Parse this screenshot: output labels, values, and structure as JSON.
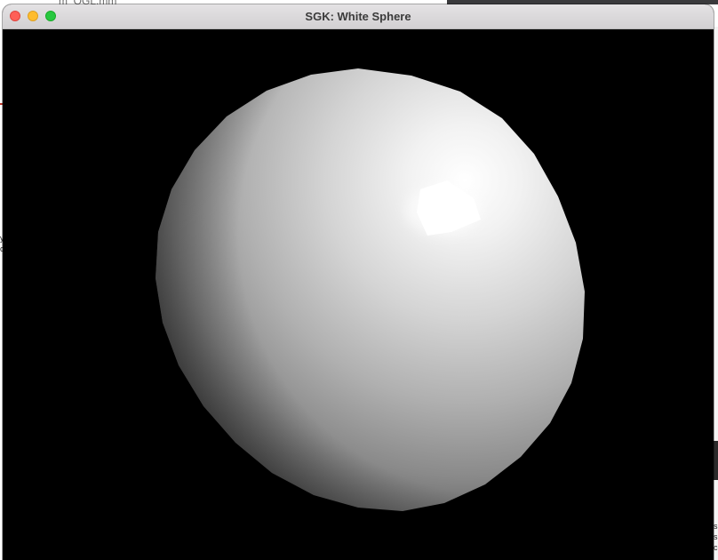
{
  "window": {
    "title": "SGK: White Sphere"
  },
  "background": {
    "filename_fragment": "m_OGL.mm"
  },
  "scene": {
    "object": "white sphere",
    "background_color": "#000000",
    "sphere_color": "#ffffff"
  }
}
